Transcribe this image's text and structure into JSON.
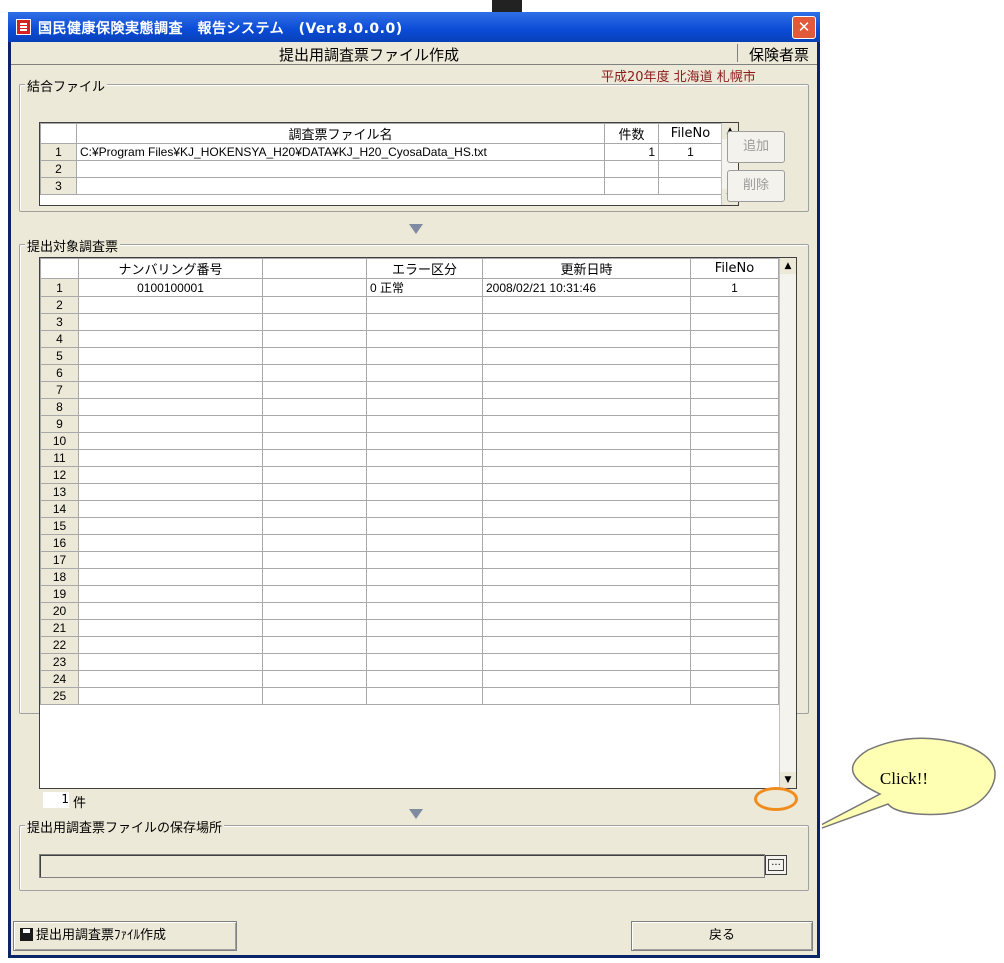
{
  "window": {
    "title": "国民健康保険実態調査　報告システム　(Ver.8.0.0.0)",
    "close_glyph": "✕",
    "screen_title": "提出用調査票ファイル作成",
    "form_type": "保険者票",
    "location": "平成20年度 北海道 札幌市"
  },
  "combined": {
    "label": "結合ファイル",
    "headers": [
      "",
      "調査票ファイル名",
      "件数",
      "FileNo"
    ],
    "rows": [
      {
        "n": "1",
        "file": "C:¥Program Files¥KJ_HOKENSYA_H20¥DATA¥KJ_H20_CyosaData_HS.txt",
        "count": "1",
        "fileno": "1"
      },
      {
        "n": "2",
        "file": "",
        "count": "",
        "fileno": ""
      },
      {
        "n": "3",
        "file": "",
        "count": "",
        "fileno": ""
      }
    ],
    "add_label": "追加",
    "delete_label": "削除"
  },
  "target": {
    "label": "提出対象調査票",
    "headers": [
      "",
      "ナンバリング番号",
      "",
      "エラー区分",
      "更新日時",
      "FileNo"
    ],
    "rows": [
      {
        "n": "1",
        "num": "0100100001",
        "blank": "",
        "err": "0 正常",
        "updated": "2008/02/21 10:31:46",
        "fileno": "1"
      },
      {
        "n": "2",
        "num": "",
        "blank": "",
        "err": "",
        "updated": "",
        "fileno": ""
      },
      {
        "n": "3",
        "num": "",
        "blank": "",
        "err": "",
        "updated": "",
        "fileno": ""
      },
      {
        "n": "4",
        "num": "",
        "blank": "",
        "err": "",
        "updated": "",
        "fileno": ""
      },
      {
        "n": "5",
        "num": "",
        "blank": "",
        "err": "",
        "updated": "",
        "fileno": ""
      },
      {
        "n": "6",
        "num": "",
        "blank": "",
        "err": "",
        "updated": "",
        "fileno": ""
      },
      {
        "n": "7",
        "num": "",
        "blank": "",
        "err": "",
        "updated": "",
        "fileno": ""
      },
      {
        "n": "8",
        "num": "",
        "blank": "",
        "err": "",
        "updated": "",
        "fileno": ""
      },
      {
        "n": "9",
        "num": "",
        "blank": "",
        "err": "",
        "updated": "",
        "fileno": ""
      },
      {
        "n": "10",
        "num": "",
        "blank": "",
        "err": "",
        "updated": "",
        "fileno": ""
      },
      {
        "n": "11",
        "num": "",
        "blank": "",
        "err": "",
        "updated": "",
        "fileno": ""
      },
      {
        "n": "12",
        "num": "",
        "blank": "",
        "err": "",
        "updated": "",
        "fileno": ""
      },
      {
        "n": "13",
        "num": "",
        "blank": "",
        "err": "",
        "updated": "",
        "fileno": ""
      },
      {
        "n": "14",
        "num": "",
        "blank": "",
        "err": "",
        "updated": "",
        "fileno": ""
      },
      {
        "n": "15",
        "num": "",
        "blank": "",
        "err": "",
        "updated": "",
        "fileno": ""
      },
      {
        "n": "16",
        "num": "",
        "blank": "",
        "err": "",
        "updated": "",
        "fileno": ""
      },
      {
        "n": "17",
        "num": "",
        "blank": "",
        "err": "",
        "updated": "",
        "fileno": ""
      },
      {
        "n": "18",
        "num": "",
        "blank": "",
        "err": "",
        "updated": "",
        "fileno": ""
      },
      {
        "n": "19",
        "num": "",
        "blank": "",
        "err": "",
        "updated": "",
        "fileno": ""
      },
      {
        "n": "20",
        "num": "",
        "blank": "",
        "err": "",
        "updated": "",
        "fileno": ""
      },
      {
        "n": "21",
        "num": "",
        "blank": "",
        "err": "",
        "updated": "",
        "fileno": ""
      },
      {
        "n": "22",
        "num": "",
        "blank": "",
        "err": "",
        "updated": "",
        "fileno": ""
      },
      {
        "n": "23",
        "num": "",
        "blank": "",
        "err": "",
        "updated": "",
        "fileno": ""
      },
      {
        "n": "24",
        "num": "",
        "blank": "",
        "err": "",
        "updated": "",
        "fileno": ""
      },
      {
        "n": "25",
        "num": "",
        "blank": "",
        "err": "",
        "updated": "",
        "fileno": ""
      }
    ],
    "count_value": "1",
    "count_unit": "件"
  },
  "save": {
    "label": "提出用調査票ファイルの保存場所",
    "path_value": "",
    "browse_glyph": "..."
  },
  "buttons": {
    "create_label": "提出用調査票ﾌｧｲﾙ作成",
    "back_label": "戻る"
  },
  "annotation": {
    "callout_text": "Click!!",
    "callout_fill": "#ffffb3",
    "highlight_color": "#f08c1e"
  },
  "icons": {
    "app": "report-app-icon",
    "close": "close-icon",
    "disk": "floppy-disk-icon",
    "browse": "ellipsis-icon",
    "arrow": "down-arrow-icon"
  }
}
